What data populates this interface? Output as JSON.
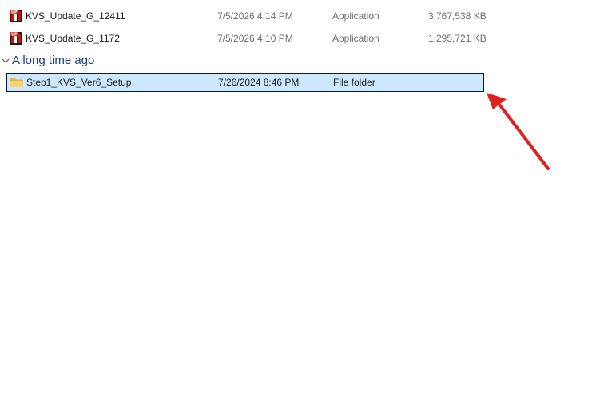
{
  "files": [
    {
      "name": "KVS_Update_G_12411",
      "date": "7/5/2026 4:14 PM",
      "type": "Application",
      "size": "3,767,538 KB",
      "icon": "installer-app-icon"
    },
    {
      "name": "KVS_Update_G_1172",
      "date": "7/5/2026 4:10 PM",
      "type": "Application",
      "size": "1,295,721 KB",
      "icon": "installer-app-icon"
    }
  ],
  "group": {
    "title": "A long time ago"
  },
  "group_files": [
    {
      "name": "Step1_KVS_Ver6_Setup",
      "date": "7/26/2024 8:46 PM",
      "type": "File folder",
      "size": "",
      "icon": "folder-icon",
      "selected": true
    }
  ],
  "colors": {
    "selection_bg": "#cce8ff",
    "group_title": "#1e3a78",
    "annotation_arrow": "#e0201e"
  }
}
